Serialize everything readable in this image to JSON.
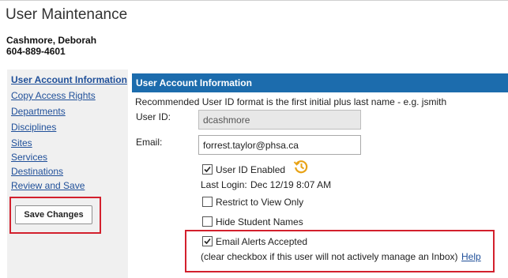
{
  "page": {
    "title": "User Maintenance"
  },
  "user": {
    "name": "Cashmore, Deborah",
    "phone": "604-889-4601"
  },
  "sidebar": {
    "items": [
      {
        "label": "User Account Information",
        "active": true
      },
      {
        "label": "Copy Access Rights"
      },
      {
        "label": "Departments"
      },
      {
        "label": "Disciplines"
      },
      {
        "label": "Sites"
      },
      {
        "label": "Services"
      },
      {
        "label": "Destinations"
      },
      {
        "label": "Review and Save"
      }
    ],
    "save_button": "Save Changes"
  },
  "panel": {
    "title": "User Account Information",
    "hint": "Recommended User ID format is the first initial plus last name - e.g. jsmith",
    "user_id_label": "User ID:",
    "user_id_value": "dcashmore",
    "email_label": "Email:",
    "email_value": "forrest.taylor@phsa.ca",
    "user_id_enabled": {
      "label": "User ID Enabled",
      "checked": true
    },
    "last_login_label": "Last Login:",
    "last_login_value": "Dec 12/19 8:07 AM",
    "restrict_view": {
      "label": "Restrict to View Only",
      "checked": false
    },
    "hide_student_names": {
      "label": "Hide Student Names",
      "checked": false
    },
    "email_alerts": {
      "label": "Email Alerts Accepted",
      "checked": true
    },
    "email_alerts_note": "(clear checkbox if this user will not actively manage an Inbox)",
    "help_link": "Help"
  },
  "colors": {
    "header_bg": "#1c6cad",
    "highlight": "#d3202d",
    "link": "#1f4f99",
    "history_icon": "#e8a317"
  },
  "icons": {
    "history": "history-icon",
    "check": "checkmark-icon"
  }
}
